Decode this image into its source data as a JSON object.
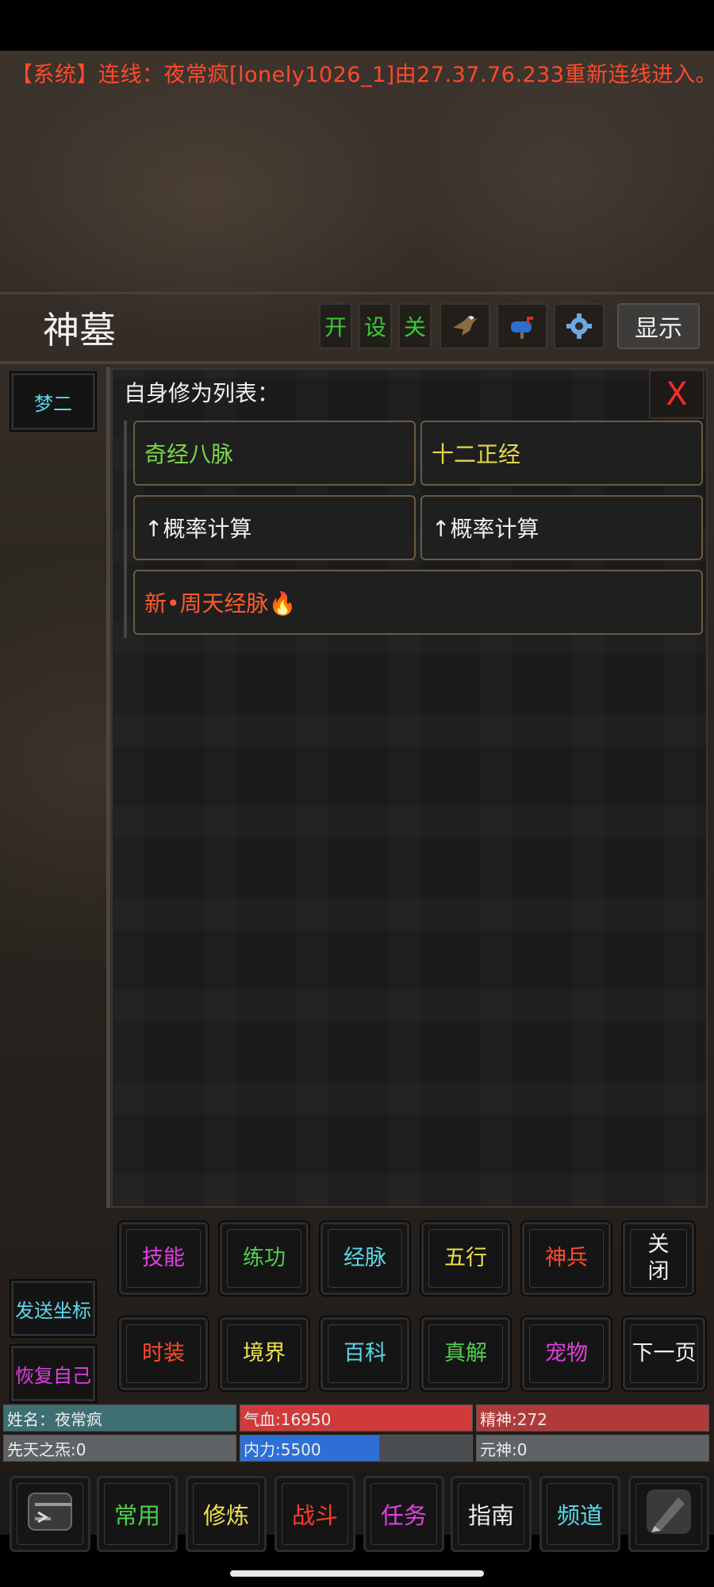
{
  "system_message": "【系统】连线：夜常疯[lonely1026_1]由27.37.76.233重新连线进入。",
  "location_title": "神墓",
  "toolbar": {
    "open_label": "开",
    "settings_label": "设",
    "close_label": "关",
    "show_label": "显示",
    "icons": [
      "eagle-icon",
      "mailbox-icon",
      "gear-icon"
    ]
  },
  "sidebar": {
    "top_label": "梦二",
    "send_coords_label": "发送坐标",
    "restore_self_label": "恢复自己"
  },
  "panel": {
    "title": "自身修为列表：",
    "close_label": "X",
    "items": [
      {
        "label": "奇经八脉",
        "color": "#7cd64a"
      },
      {
        "label": "十二正经",
        "color": "#e6d84a"
      },
      {
        "label": "↑概率计算",
        "color": "#f0f0f0"
      },
      {
        "label": "↑概率计算",
        "color": "#f0f0f0"
      },
      {
        "label": "新•周天经脉🔥",
        "color": "#ff5a2a"
      }
    ]
  },
  "action_grid": [
    {
      "label": "技能",
      "color": "#e040e0"
    },
    {
      "label": "练功",
      "color": "#4ccf4c"
    },
    {
      "label": "经脉",
      "color": "#5ad8ea"
    },
    {
      "label": "五行",
      "color": "#f0e050"
    },
    {
      "label": "神兵",
      "color": "#ff4a2a"
    },
    {
      "label": "关闭",
      "color": "#f0f0f0"
    },
    {
      "label": "时装",
      "color": "#ff4a2a"
    },
    {
      "label": "境界",
      "color": "#f0e050"
    },
    {
      "label": "百科",
      "color": "#5ad8ea"
    },
    {
      "label": "真解",
      "color": "#4ccf4c"
    },
    {
      "label": "宠物",
      "color": "#e040e0"
    },
    {
      "label": "下一页",
      "color": "#f0f0f0"
    }
  ],
  "stats": {
    "name": "姓名：夜常疯",
    "hp": "气血:16950",
    "spirit": "精神:272",
    "innate": "先天之炁:0",
    "neili": "内力:5500",
    "yuanshen": "元神:0",
    "neili_fraction": 0.6
  },
  "bottom_nav": [
    {
      "label": "",
      "icon": "terminal-icon",
      "color": "#cccccc"
    },
    {
      "label": "常用",
      "color": "#4ccf4c"
    },
    {
      "label": "修炼",
      "color": "#f0e050"
    },
    {
      "label": "战斗",
      "color": "#ff3a2a"
    },
    {
      "label": "任务",
      "color": "#e040e0"
    },
    {
      "label": "指南",
      "color": "#f0f0f0"
    },
    {
      "label": "频道",
      "color": "#5ad8ea"
    },
    {
      "label": "",
      "icon": "stylus-icon",
      "color": "#cccccc"
    }
  ]
}
